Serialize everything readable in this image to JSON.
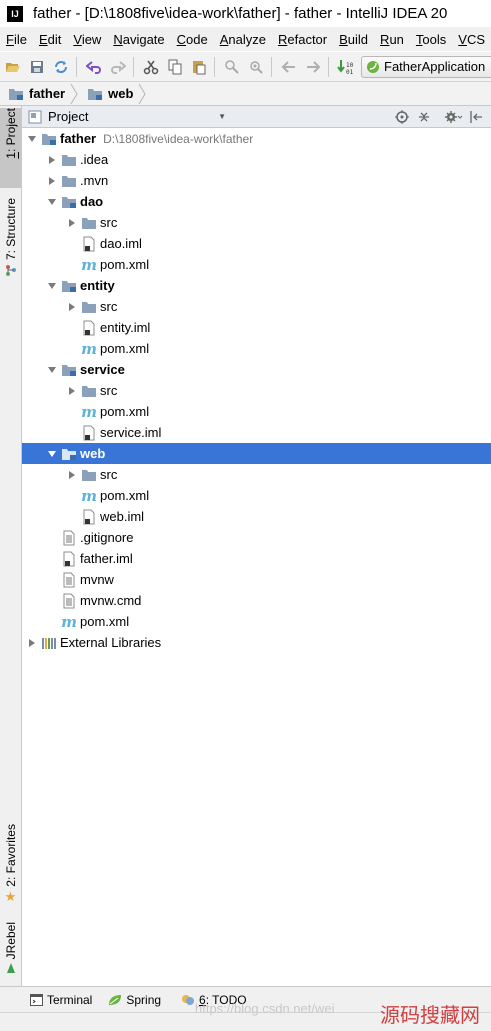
{
  "window": {
    "title": "father - [D:\\1808five\\idea-work\\father] - father - IntelliJ IDEA 20",
    "logo_text": "IJ"
  },
  "menu": [
    "File",
    "Edit",
    "View",
    "Navigate",
    "Code",
    "Analyze",
    "Refactor",
    "Build",
    "Run",
    "Tools",
    "VCS"
  ],
  "toolbar": {
    "run_config": "FatherApplication"
  },
  "navbar": {
    "crumbs": [
      "father",
      "web"
    ]
  },
  "left_tool_tabs": {
    "project": "1: Project",
    "structure": "7: Structure",
    "favorites": "2: Favorites",
    "jrebel": "JRebel"
  },
  "project_panel": {
    "view_selector": "Project",
    "tree": [
      {
        "label": "father",
        "path": "D:\\1808five\\idea-work\\father",
        "depth": 0,
        "expanded": true,
        "type": "module",
        "bold": true
      },
      {
        "label": ".idea",
        "depth": 1,
        "expanded": false,
        "type": "folder"
      },
      {
        "label": ".mvn",
        "depth": 1,
        "expanded": false,
        "type": "folder"
      },
      {
        "label": "dao",
        "depth": 1,
        "expanded": true,
        "type": "module",
        "bold": true
      },
      {
        "label": "src",
        "depth": 2,
        "expanded": false,
        "type": "folder"
      },
      {
        "label": "dao.iml",
        "depth": 2,
        "type": "iml"
      },
      {
        "label": "pom.xml",
        "depth": 2,
        "type": "maven"
      },
      {
        "label": "entity",
        "depth": 1,
        "expanded": true,
        "type": "module",
        "bold": true
      },
      {
        "label": "src",
        "depth": 2,
        "expanded": false,
        "type": "folder"
      },
      {
        "label": "entity.iml",
        "depth": 2,
        "type": "iml"
      },
      {
        "label": "pom.xml",
        "depth": 2,
        "type": "maven"
      },
      {
        "label": "service",
        "depth": 1,
        "expanded": true,
        "type": "module",
        "bold": true
      },
      {
        "label": "src",
        "depth": 2,
        "expanded": false,
        "type": "folder"
      },
      {
        "label": "pom.xml",
        "depth": 2,
        "type": "maven"
      },
      {
        "label": "service.iml",
        "depth": 2,
        "type": "iml"
      },
      {
        "label": "web",
        "depth": 1,
        "expanded": true,
        "type": "module",
        "bold": true,
        "selected": true
      },
      {
        "label": "src",
        "depth": 2,
        "expanded": false,
        "type": "folder"
      },
      {
        "label": "pom.xml",
        "depth": 2,
        "type": "maven"
      },
      {
        "label": "web.iml",
        "depth": 2,
        "type": "iml"
      },
      {
        "label": ".gitignore",
        "depth": 1,
        "type": "text"
      },
      {
        "label": "father.iml",
        "depth": 1,
        "type": "iml"
      },
      {
        "label": "mvnw",
        "depth": 1,
        "type": "text"
      },
      {
        "label": "mvnw.cmd",
        "depth": 1,
        "type": "text"
      },
      {
        "label": "pom.xml",
        "depth": 1,
        "type": "maven"
      },
      {
        "label": "External Libraries",
        "depth": 0,
        "expanded": false,
        "type": "libraries"
      }
    ]
  },
  "bottom_tabs": {
    "terminal": "Terminal",
    "spring": "Spring",
    "todo_num": "6",
    "todo": ": TODO"
  },
  "watermark": {
    "url": "https://blog.csdn.net/wei",
    "logo": "源码搜藏网"
  },
  "colors": {
    "selection": "#3875d6",
    "maven_icon": "#5fb3d8",
    "folder": "#8aa1b9"
  }
}
